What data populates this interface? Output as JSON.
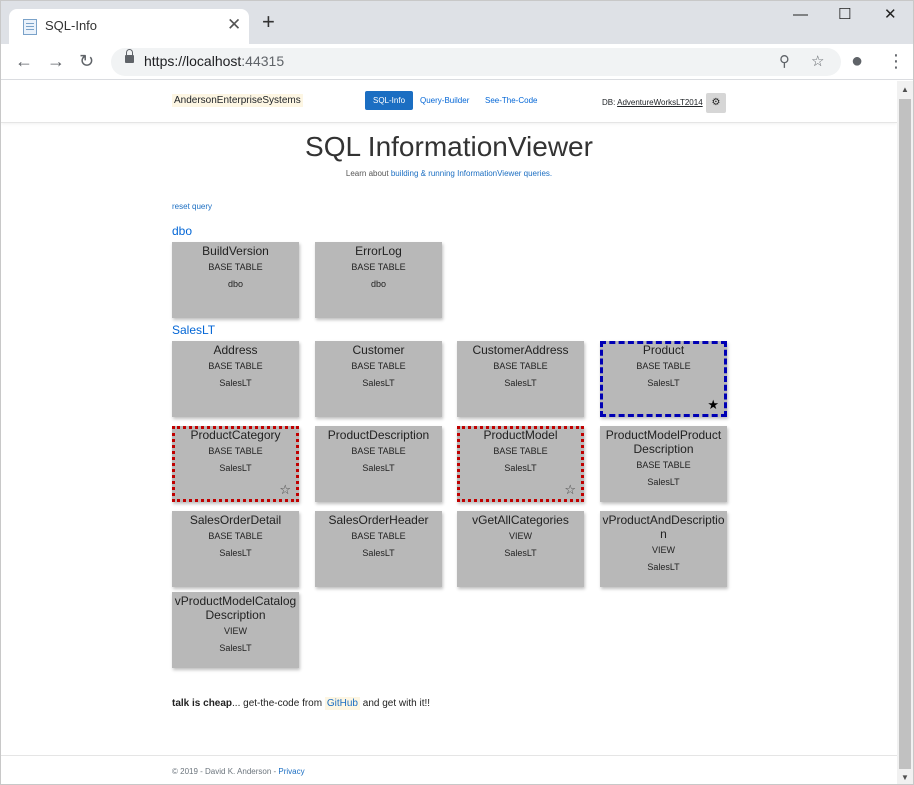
{
  "browser": {
    "tab_title": "SQL-Info",
    "url_host": "https://localhost",
    "url_port": ":44315"
  },
  "nav": {
    "brand": "AndersonEnterpriseSystems",
    "links": [
      "SQL-Info",
      "Query-Builder",
      "See-The-Code"
    ],
    "db_prefix": "DB:",
    "db_name": "AdventureWorksLT2014"
  },
  "header": {
    "title": "SQL InformationViewer",
    "subtitle_prefix": "Learn about ",
    "subtitle_link": "building & running InformationViewer queries."
  },
  "reset_label": "reset query",
  "schemas": [
    {
      "name": "dbo",
      "cards": [
        {
          "name": "BuildVersion",
          "type": "BASE TABLE",
          "schema": "dbo"
        },
        {
          "name": "ErrorLog",
          "type": "BASE TABLE",
          "schema": "dbo"
        }
      ]
    },
    {
      "name": "SalesLT",
      "cards": [
        {
          "name": "Address",
          "type": "BASE TABLE",
          "schema": "SalesLT"
        },
        {
          "name": "Customer",
          "type": "BASE TABLE",
          "schema": "SalesLT"
        },
        {
          "name": "CustomerAddress",
          "type": "BASE TABLE",
          "schema": "SalesLT"
        },
        {
          "name": "Product",
          "type": "BASE TABLE",
          "schema": "SalesLT"
        },
        {
          "name": "ProductCategory",
          "type": "BASE TABLE",
          "schema": "SalesLT"
        },
        {
          "name": "ProductDescription",
          "type": "BASE TABLE",
          "schema": "SalesLT"
        },
        {
          "name": "ProductModel",
          "type": "BASE TABLE",
          "schema": "SalesLT"
        },
        {
          "name": "ProductModelProduct Description",
          "type": "BASE TABLE",
          "schema": "SalesLT"
        },
        {
          "name": "SalesOrderDetail",
          "type": "BASE TABLE",
          "schema": "SalesLT"
        },
        {
          "name": "SalesOrderHeader",
          "type": "BASE TABLE",
          "schema": "SalesLT"
        },
        {
          "name": "vGetAllCategories",
          "type": "VIEW",
          "schema": "SalesLT"
        },
        {
          "name": "vProductAndDescriptio n",
          "type": "VIEW",
          "schema": "SalesLT"
        },
        {
          "name": "vProductModelCatalog Description",
          "type": "VIEW",
          "schema": "SalesLT"
        }
      ]
    }
  ],
  "footer": {
    "bold": "talk is cheap",
    "middle": "... get-the-code from ",
    "github": "GitHub",
    "tail": " and get with it!!",
    "copyright": "© 2019 - David K. Anderson - ",
    "privacy": "Privacy"
  }
}
